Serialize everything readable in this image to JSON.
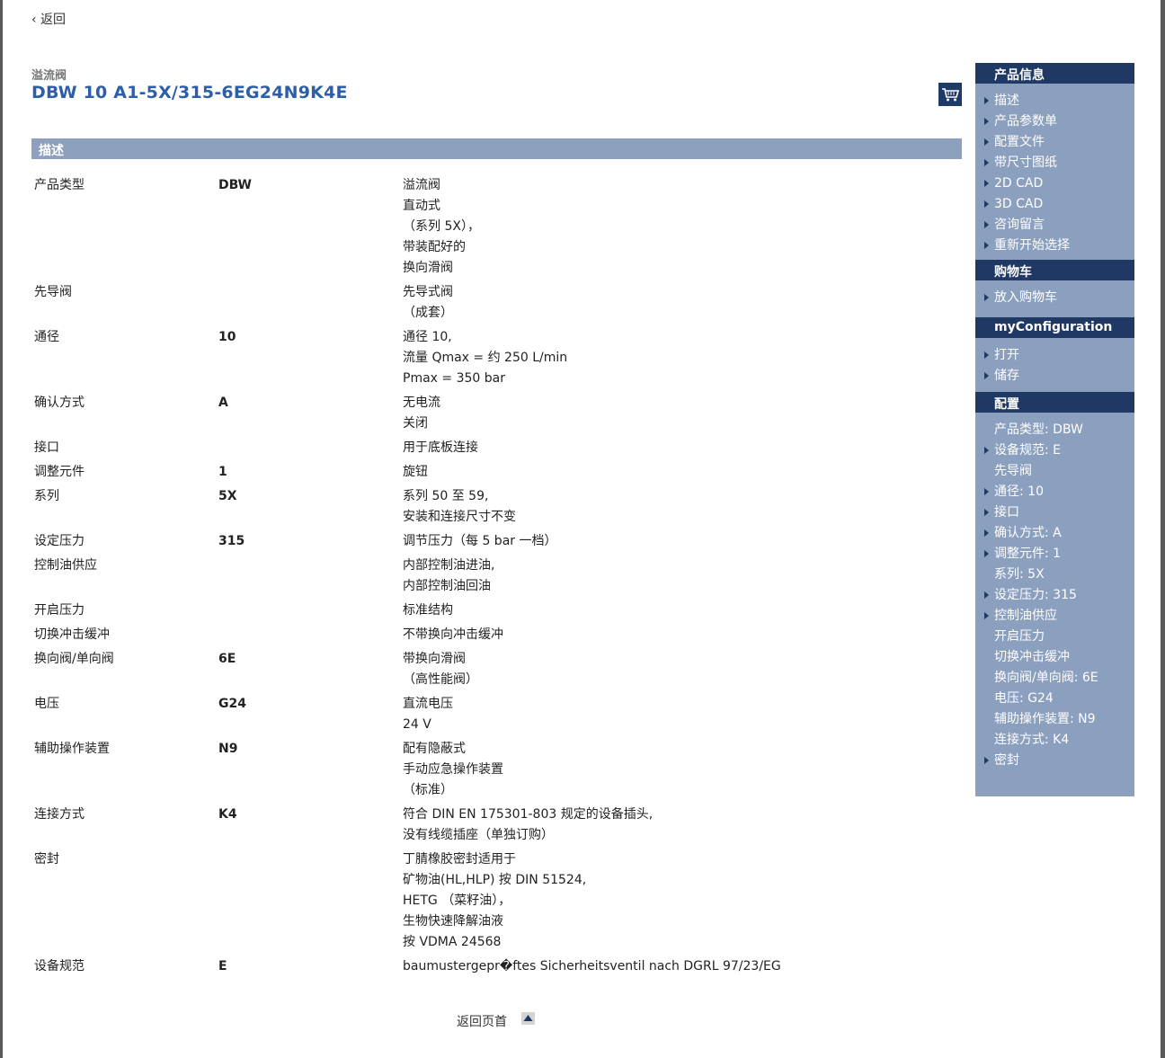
{
  "nav": {
    "back_label": "‹ 返回"
  },
  "product": {
    "category": "溢流阀",
    "title": "DBW 10 A1-5X/315-6EG24N9K4E"
  },
  "description_section": {
    "heading": "描述",
    "rows": [
      {
        "name": "产品类型",
        "code": "DBW",
        "desc": [
          "溢流阀",
          "直动式",
          "（系列 5X），",
          "带装配好的",
          "换向滑阀"
        ]
      },
      {
        "name": "先导阀",
        "code": "",
        "desc": [
          "先导式阀",
          "（成套）"
        ]
      },
      {
        "name": "通径",
        "code": "10",
        "desc": [
          "通径 10,",
          "流量 Qmax = 约 250 L/min",
          "Pmax = 350 bar"
        ]
      },
      {
        "name": "确认方式",
        "code": "A",
        "desc": [
          "无电流",
          "关闭"
        ]
      },
      {
        "name": "接口",
        "code": "",
        "desc": [
          "用于底板连接"
        ]
      },
      {
        "name": "调整元件",
        "code": "1",
        "desc": [
          "旋钮"
        ]
      },
      {
        "name": "系列",
        "code": "5X",
        "desc": [
          "系列 50 至 59,",
          "安装和连接尺寸不变"
        ]
      },
      {
        "name": "设定压力",
        "code": "315",
        "desc": [
          "调节压力（每 5 bar 一档）"
        ]
      },
      {
        "name": "控制油供应",
        "code": "",
        "desc": [
          "内部控制油进油,",
          "内部控制油回油"
        ]
      },
      {
        "name": "开启压力",
        "code": "",
        "desc": [
          "标准结构"
        ]
      },
      {
        "name": "切换冲击缓冲",
        "code": "",
        "desc": [
          "不带换向冲击缓冲"
        ]
      },
      {
        "name": "换向阀/单向阀",
        "code": "6E",
        "desc": [
          "带换向滑阀",
          "（高性能阀）"
        ]
      },
      {
        "name": "电压",
        "code": "G24",
        "desc": [
          "直流电压",
          "24 V"
        ]
      },
      {
        "name": "辅助操作装置",
        "code": "N9",
        "desc": [
          "配有隐蔽式",
          "手动应急操作装置",
          "（标准）"
        ]
      },
      {
        "name": "连接方式",
        "code": "K4",
        "desc": [
          "符合 DIN EN 175301-803 规定的设备插头,",
          "没有线缆插座（单独订购）"
        ]
      },
      {
        "name": "密封",
        "code": "",
        "desc": [
          "丁腈橡胶密封适用于",
          "矿物油(HL,HLP) 按 DIN 51524,",
          "HETG （菜籽油），",
          "生物快速降解油液",
          "按 VDMA 24568"
        ]
      },
      {
        "name": "设备规范",
        "code": "E",
        "desc": [
          "baumustergepr�ftes Sicherheitsventil nach DGRL 97/23/EG"
        ]
      }
    ]
  },
  "footer": {
    "back_to_top_label": "返回页首"
  },
  "sidebar": {
    "product_info": {
      "heading": "产品信息",
      "items": [
        "描述",
        "产品参数单",
        "配置文件",
        "带尺寸图纸",
        "2D CAD",
        "3D CAD",
        "咨询留言",
        "重新开始选择"
      ]
    },
    "cart": {
      "heading": "购物车",
      "items": [
        "放入购物车"
      ]
    },
    "myconfig": {
      "heading": "myConfiguration",
      "items": [
        "打开",
        "储存"
      ]
    },
    "config": {
      "heading": "配置",
      "items": [
        {
          "label": "产品类型: DBW",
          "link": false
        },
        {
          "label": "设备规范: E",
          "link": true
        },
        {
          "label": "先导阀",
          "link": false
        },
        {
          "label": "通径: 10",
          "link": true
        },
        {
          "label": "接口",
          "link": true
        },
        {
          "label": "确认方式: A",
          "link": true
        },
        {
          "label": "调整元件: 1",
          "link": true
        },
        {
          "label": "系列: 5X",
          "link": false
        },
        {
          "label": "设定压力: 315",
          "link": true
        },
        {
          "label": "控制油供应",
          "link": true
        },
        {
          "label": "开启压力",
          "link": false
        },
        {
          "label": "切换冲击缓冲",
          "link": false
        },
        {
          "label": "换向阀/单向阀: 6E",
          "link": false
        },
        {
          "label": "电压: G24",
          "link": false
        },
        {
          "label": "辅助操作装置: N9",
          "link": false
        },
        {
          "label": "连接方式: K4",
          "link": false
        },
        {
          "label": "密封",
          "link": true
        }
      ]
    }
  }
}
